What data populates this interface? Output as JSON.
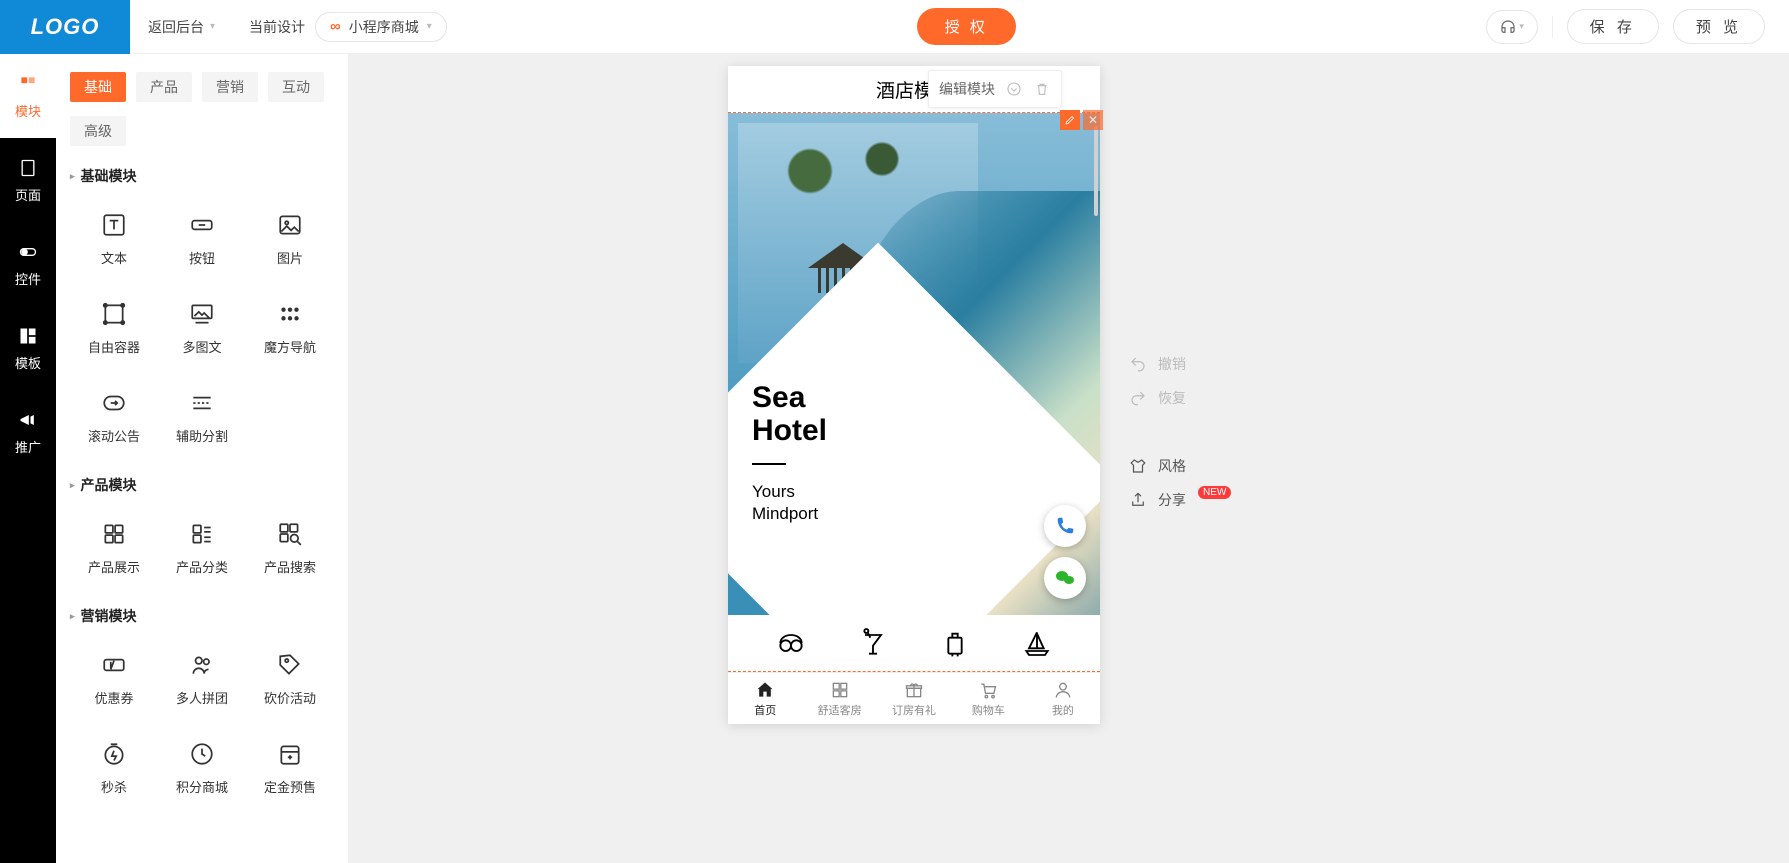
{
  "topbar": {
    "logo": "LOGO",
    "back": "返回后台",
    "design_label": "当前设计",
    "design_value": "小程序商城",
    "authorize": "授 权",
    "save": "保 存",
    "preview": "预 览"
  },
  "rail": [
    {
      "label": "模块",
      "icon": "blocks-icon",
      "active": true
    },
    {
      "label": "页面",
      "icon": "page-icon",
      "active": false
    },
    {
      "label": "控件",
      "icon": "toggle-icon",
      "active": false
    },
    {
      "label": "模板",
      "icon": "layout-icon",
      "active": false
    },
    {
      "label": "推广",
      "icon": "megaphone-icon",
      "active": false
    }
  ],
  "panel": {
    "tabs": [
      "基础",
      "产品",
      "营销",
      "互动"
    ],
    "tabs2": [
      "高级"
    ],
    "active_tab": "基础",
    "sections": [
      {
        "title": "基础模块",
        "items": [
          {
            "label": "文本",
            "icon": "text-icon"
          },
          {
            "label": "按钮",
            "icon": "button-icon"
          },
          {
            "label": "图片",
            "icon": "image-icon"
          },
          {
            "label": "自由容器",
            "icon": "container-icon"
          },
          {
            "label": "多图文",
            "icon": "gallery-icon"
          },
          {
            "label": "魔方导航",
            "icon": "grid-icon"
          },
          {
            "label": "滚动公告",
            "icon": "notice-icon"
          },
          {
            "label": "辅助分割",
            "icon": "divider-icon"
          }
        ]
      },
      {
        "title": "产品模块",
        "items": [
          {
            "label": "产品展示",
            "icon": "product-display-icon"
          },
          {
            "label": "产品分类",
            "icon": "product-category-icon"
          },
          {
            "label": "产品搜索",
            "icon": "product-search-icon"
          }
        ]
      },
      {
        "title": "营销模块",
        "items": [
          {
            "label": "优惠券",
            "icon": "coupon-icon"
          },
          {
            "label": "多人拼团",
            "icon": "group-buy-icon"
          },
          {
            "label": "砍价活动",
            "icon": "bargain-icon"
          },
          {
            "label": "秒杀",
            "icon": "flash-sale-icon"
          },
          {
            "label": "积分商城",
            "icon": "points-mall-icon"
          },
          {
            "label": "定金预售",
            "icon": "presale-icon"
          }
        ]
      }
    ]
  },
  "mod_toolbar": {
    "label": "编辑模块"
  },
  "phone": {
    "title": "酒店模板",
    "hero": {
      "t1a": "Sea",
      "t1b": "Hotel",
      "t2a": "Yours",
      "t2b": "Mindport"
    },
    "tabbar": [
      {
        "label": "首页",
        "active": true
      },
      {
        "label": "舒适客房",
        "active": false
      },
      {
        "label": "订房有礼",
        "active": false
      },
      {
        "label": "购物车",
        "active": false
      },
      {
        "label": "我的",
        "active": false
      }
    ]
  },
  "rtools": {
    "undo": "撤销",
    "redo": "恢复",
    "style": "风格",
    "share": "分享",
    "new_badge": "NEW"
  }
}
